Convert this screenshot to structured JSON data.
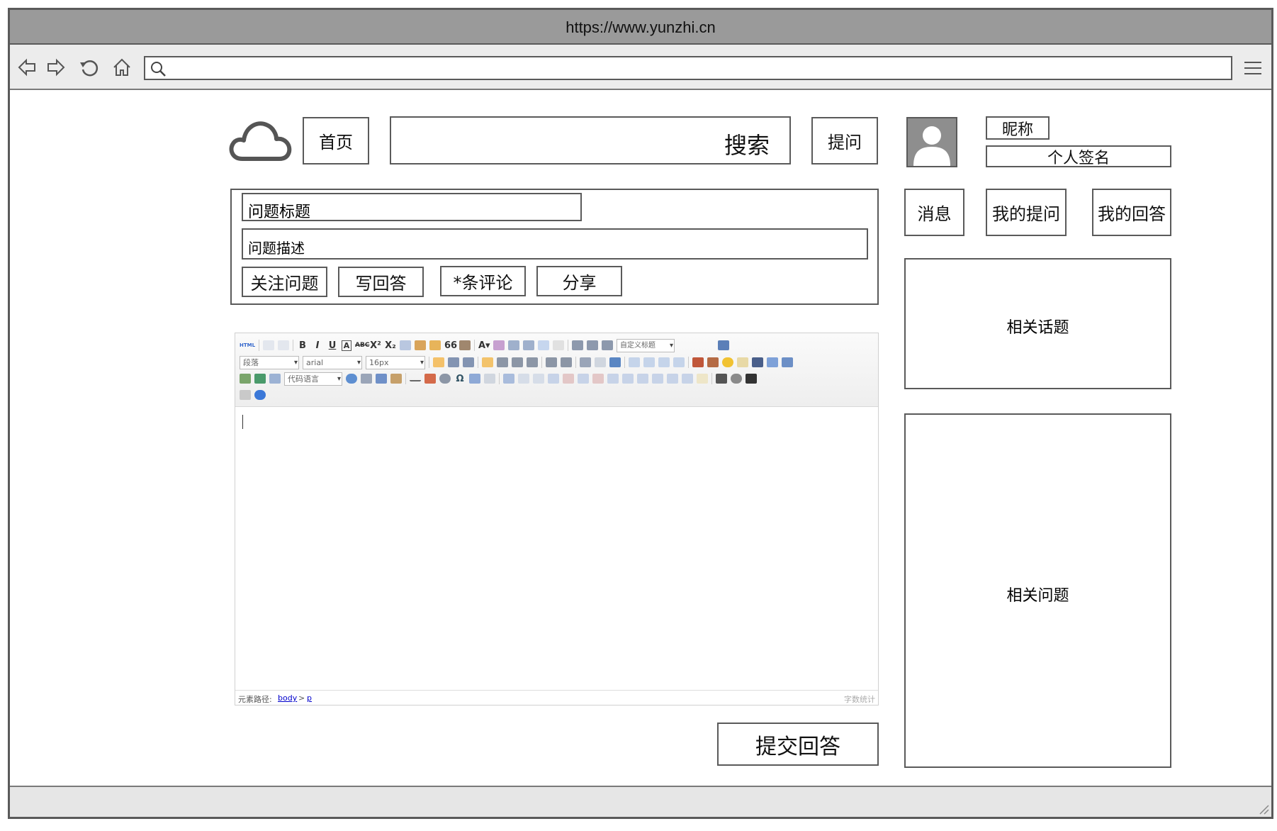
{
  "browser": {
    "url_title": "https://www.yunzhi.cn",
    "search_placeholder": ""
  },
  "header": {
    "home": "首页",
    "search_label": "搜索",
    "ask": "提问"
  },
  "profile": {
    "nickname": "昵称",
    "signature": "个人签名"
  },
  "user_nav": {
    "messages": "消息",
    "my_questions": "我的提问",
    "my_answers": "我的回答"
  },
  "question": {
    "title": "问题标题",
    "description": "问题描述",
    "actions": [
      "关注问题",
      "写回答",
      "*条评论",
      "分享"
    ]
  },
  "editor": {
    "paragraph_select": "段落",
    "font_select": "arial",
    "size_select": "16px",
    "code_lang_select": "代码语言",
    "custom_heading_select": "自定义标题",
    "html_label": "HTML",
    "path_label": "元素路径:",
    "path_body": "body",
    "path_sep": ">",
    "path_p": "p",
    "word_count": "字数统计"
  },
  "submit_label": "提交回答",
  "sidebar": {
    "related_topics": "相关话题",
    "related_questions": "相关问题"
  },
  "colors": {
    "border": "#5a5a5a",
    "titlebar": "#9a9a9a",
    "link": "#0000cc"
  }
}
